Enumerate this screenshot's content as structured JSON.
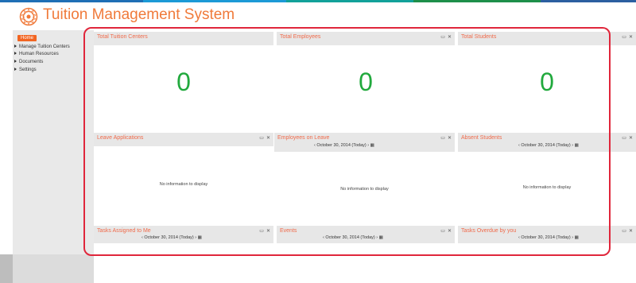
{
  "app": {
    "title": "Tuition Management System"
  },
  "colors": {
    "accent": "#f26522",
    "title": "#f07a3a",
    "panel_title": "#f06a4a",
    "big_number": "#21a93d",
    "highlight": "#e0263b"
  },
  "sidebar": {
    "home_label": "Home",
    "items": [
      {
        "label": "Manage Tuition Centers"
      },
      {
        "label": "Human Resources"
      },
      {
        "label": "Documents"
      },
      {
        "label": "Settings"
      }
    ]
  },
  "icons": {
    "minimize": "window-icon",
    "close": "close-icon",
    "prev": "chevron-left-icon",
    "next": "chevron-right-icon",
    "calendar": "calendar-icon",
    "logo": "logo-icon"
  },
  "widgets": {
    "total_tuition_centers": {
      "title": "Total Tuition Centers",
      "value": "0"
    },
    "total_employees": {
      "title": "Total Employees",
      "value": "0"
    },
    "total_students": {
      "title": "Total Students",
      "value": "0"
    },
    "leave_applications": {
      "title": "Leave Applications",
      "empty": "No information to display"
    },
    "employees_on_leave": {
      "title": "Employees on Leave",
      "date": "October 30, 2014 (Today)",
      "empty": "No information to display"
    },
    "absent_students": {
      "title": "Absent Students",
      "date": "October 30, 2014 (Today)",
      "empty": "No information to display"
    },
    "tasks_assigned": {
      "title": "Tasks Assigned to Me",
      "date": "October 30, 2014 (Today)"
    },
    "events": {
      "title": "Events",
      "date": "October 30, 2014 (Today)"
    },
    "tasks_overdue": {
      "title": "Tasks Overdue by you",
      "date": "October 30, 2014 (Today)"
    }
  },
  "glyphs": {
    "minimize": "▭",
    "close": "✕",
    "prev": "‹",
    "next": "›",
    "calendar": "▦"
  }
}
